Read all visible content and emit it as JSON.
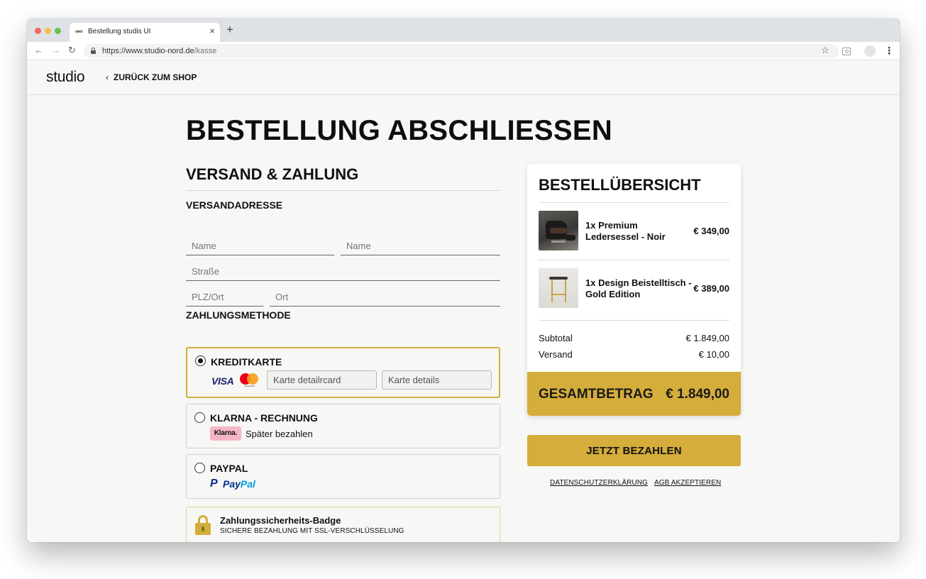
{
  "browser": {
    "tab_favicon": "nørd",
    "tab_title": "Bestellung studis UI",
    "tab_close": "×",
    "new_tab": "+",
    "url_host": "https://www.studio-nord.de",
    "url_path": "/kasse"
  },
  "header": {
    "logo": "studio",
    "back_link": "ZURÜCK ZUM SHOP"
  },
  "main": {
    "page_title": "BESTELLUNG ABSCHLIESSEN",
    "section_title": "VERSAND & ZAHLUNG",
    "shipping": {
      "heading": "VERSANDADRESSE",
      "first_name": "Name",
      "last_name": "Name",
      "street": "Straße",
      "zip": "PLZ/Ort",
      "city": "Ort"
    },
    "payment": {
      "heading": "ZAHLUNGSMETHODE",
      "credit_card": {
        "label": "KREDITKARTE",
        "visa": "VISA",
        "mastercard_caption": "mastercard",
        "card_number_placeholder": "Karte detailrcard",
        "card_details_placeholder": "Karte details",
        "selected": true
      },
      "klarna": {
        "label": "KLARNA - RECHNUNG",
        "badge": "Klarna.",
        "sub": "Später bezahlen"
      },
      "paypal": {
        "label": "PAYPAL",
        "logo_p": "P",
        "logo_pay": "Pay",
        "logo_pal": "Pal"
      }
    },
    "security": {
      "title": "Zahlungssicherheits-Badge",
      "subtitle": "SICHERE BEZAHLUNG MIT SSL-VERSCHLÜSSELUNG"
    }
  },
  "summary": {
    "title": "BESTELLÜBERSICHT",
    "items": [
      {
        "name": "1x Premium Ledersessel - Noir",
        "price": "€ 349,00"
      },
      {
        "name": "1x Design Beistelltisch - Gold Edition",
        "price": "€ 389,00"
      }
    ],
    "subtotal_label": "Subtotal",
    "subtotal_value": "€ 1.849,00",
    "shipping_label": "Versand",
    "shipping_value": "€ 10,00",
    "total_label": "GESAMTBETRAG",
    "total_value": "€ 1.849,00"
  },
  "actions": {
    "pay_now": "JETZT BEZAHLEN",
    "privacy_link": "DATENSCHUTZERKLÄRUNG",
    "terms_link": "AGB AKZEPTIEREN"
  },
  "colors": {
    "accent": "#d4ad3a",
    "klarna_pink": "#f5b7c5",
    "visa_blue": "#1a1f71",
    "paypal_dark": "#003087",
    "paypal_light": "#009cde"
  },
  "icons": {
    "back": "chevron-left-icon",
    "lock": "lock-icon",
    "star": "star-icon",
    "menu": "kebab-menu-icon",
    "security": "padlock-icon"
  }
}
